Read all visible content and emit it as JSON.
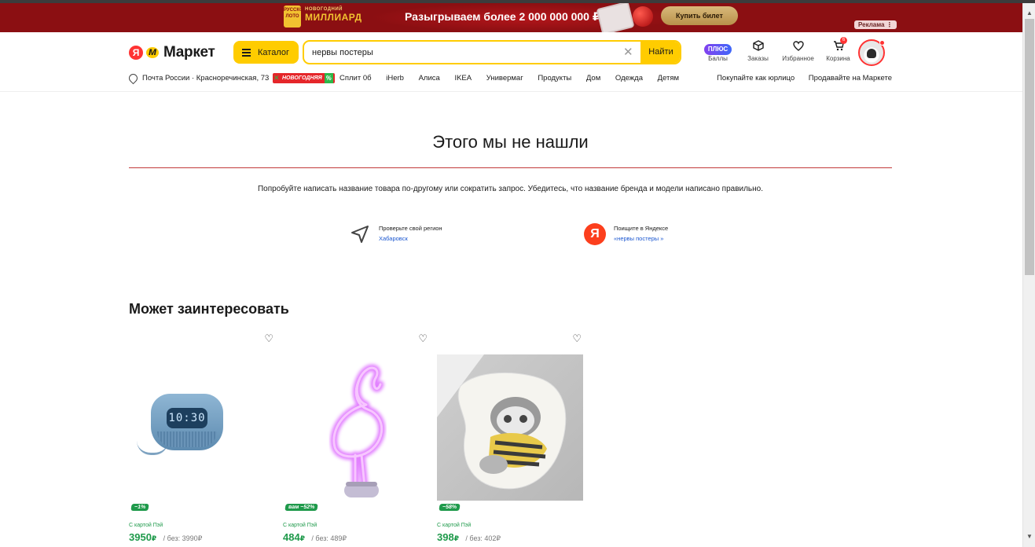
{
  "banner": {
    "lotto_badge": "РУССКОЕ ЛОТО",
    "lotto_small": "НОВОГОДНИЙ",
    "lotto_title": "МИЛЛИАРД",
    "promo_text": "Разыгрываем более 2 000 000 000 ₽",
    "buy_label": "Купить билет",
    "ad_label": "Реклама",
    "ad_menu": "⋮"
  },
  "header": {
    "logo_ya": "Я",
    "logo_word": "Маркет",
    "catalog_label": "Каталог",
    "search_value": "нервы постеры",
    "search_button": "Найти",
    "icons": [
      {
        "name": "plus-badge",
        "label": "Баллы",
        "glyph": "ПЛЮС"
      },
      {
        "name": "box-icon",
        "label": "Заказы",
        "glyph": "⬡"
      },
      {
        "name": "heart-icon",
        "label": "Избранное",
        "glyph": "♡"
      },
      {
        "name": "cart-icon",
        "label": "Корзина",
        "glyph": "🛒",
        "badge": "6"
      }
    ]
  },
  "subnav": {
    "location": "Почта России · Красноречинская, 73",
    "ny_badge": "НОВОГОДНЯЯ",
    "links": [
      "Сплит 0б",
      "iHerb",
      "Алиса",
      "IKEA",
      "Универмаг",
      "Продукты",
      "Дом",
      "Одежда",
      "Детям"
    ],
    "right_links": [
      "Покупайте как юрлицо",
      "Продавайте на Маркете"
    ]
  },
  "not_found": {
    "title": "Этого мы не нашли",
    "hint": "Попробуйте написать название товара по-другому или сократить запрос. Убедитесь, что название бренда и модели написано правильно.",
    "tip_region_title": "Проверьте свой регион",
    "tip_region_value": "Хабаровск",
    "tip_yandex_title": "Поищите в Яндексе",
    "tip_yandex_value": "«нервы постеры »",
    "yandex_letter": "Я"
  },
  "recommend": {
    "title": "Может заинтересовать",
    "cards": [
      {
        "discount": "−1%",
        "pay": "С картой Пэй",
        "price": "3950",
        "currency": "₽",
        "old": "/ без: 3990₽",
        "screen": "10:30"
      },
      {
        "discount": "вам −52%",
        "pay": "С картой Пэй",
        "price": "484",
        "currency": "₽",
        "old": "/ без: 489₽"
      },
      {
        "discount": "−58%",
        "pay": "С картой Пэй",
        "price": "398",
        "currency": "₽",
        "old": "/ без: 402₽"
      }
    ]
  },
  "colors": {
    "brand_yellow": "#ffcc00",
    "banner_red": "#8b0f12",
    "price_green": "#1f9a4b",
    "link_blue": "#1b57d0",
    "divider_red": "#c23a3a"
  }
}
